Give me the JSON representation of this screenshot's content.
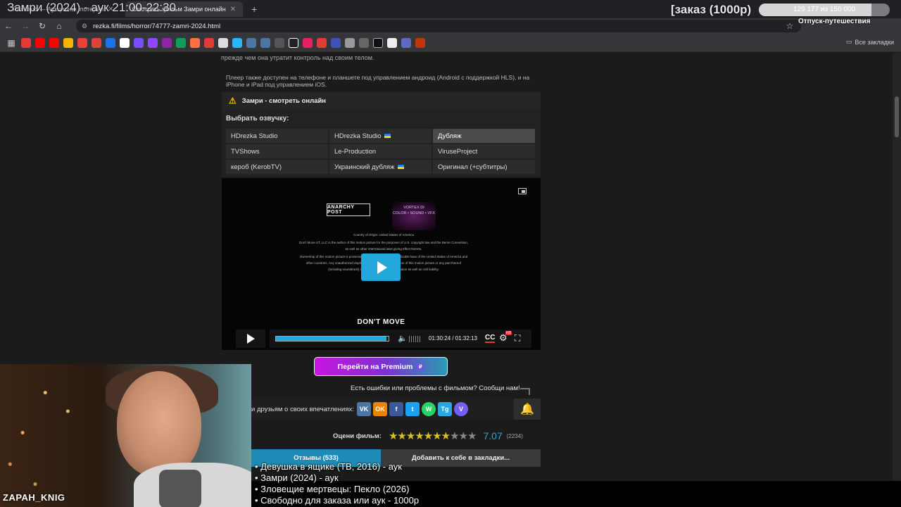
{
  "overlay": {
    "stream_title": "Замри (2024) - аук 21:00-22:30",
    "order_label": "[заказ (1000р)",
    "goal_text": "129 177 из 150 000",
    "goal_fraction": 0.861,
    "trip_label": "Отпуск-путешествия",
    "streamer_name": "ZAPAH_KNIG",
    "queue": [
      "• Девушка в ящике (ТВ, 2016) - аук",
      "• Замри (2024) - аук",
      "• Зловещие мертвецы: Пекло (2026)",
      "• Свободно для заказа или аук - 1000р"
    ]
  },
  "browser": {
    "tabs": [
      {
        "label": "Pointauc — Аукционы, лотереи"
      },
      {
        "label": "Смотреть фильм Замри онлайн"
      }
    ],
    "url": "rezka.fi/films/horror/74777-zamri-2024.html",
    "all_bookmarks": "Все закладки"
  },
  "page": {
    "cut_text": "прежде чем она утратит контроль над своим телом.",
    "info_text": "Плеер также доступен на телефоне и планшете под управлением андроид (Android с поддержкой HLS), и на iPhone и iPad под управлением iOS.",
    "panel_title": "Замри - смотреть онлайн",
    "voice_label": "Выбрать озвучку:",
    "voices": [
      "HDrezka Studio",
      "HDrezka Studio",
      "Дубляж",
      "TVShows",
      "Le-Production",
      "ViruseProject",
      "кероб (KerobTV)",
      "Украинский дубляж",
      "Оригинал (+субтитры)"
    ],
    "player": {
      "logo1": "ANARCHY POST",
      "logo2_title": "VORTEX DI",
      "logo2_sub": "COLOR • SOUND • VFX",
      "credits": [
        "Country of Origin: United States of America",
        "Don't Move UT, LLC is the author of this motion picture for the purposes of U.S. copyright law and the Berne Convention, as well as other international laws giving effect thereto.",
        "Ownership of this motion picture is protected by copyright and other applicable laws of the United States of America and other countries. Any unauthorized duplication, distribution or exhibition of this motion picture or any part thereof (including soundtrack) may result in criminal prosecution as well as civil liability."
      ],
      "movie_name": "DON'T MOVE",
      "time": "01:30:24 / 01:32:13",
      "progress_fraction": 0.98,
      "cc": "CC",
      "hd_badge": "HD"
    },
    "premium_label": "Перейти на Premium",
    "report_text": "Есть ошибки или проблемы с фильмом? Сообщи нам!",
    "share_label": "и друзьям о своих впечатлениях:",
    "socials": [
      "VK",
      "OK",
      "f",
      "t",
      "W",
      "Tg",
      "V"
    ],
    "rating_label": "Оцени фильм:",
    "rating_stars": 7,
    "rating_max": 10,
    "score": "7.07",
    "votes": "(2234)",
    "tab_reviews": "Отзывы (533)",
    "tab_bookmarks": "Добавить к себе в закладки..."
  },
  "colors": {
    "accent": "#23a7dc",
    "star": "#d8c025",
    "premium_start": "#c815e0"
  }
}
